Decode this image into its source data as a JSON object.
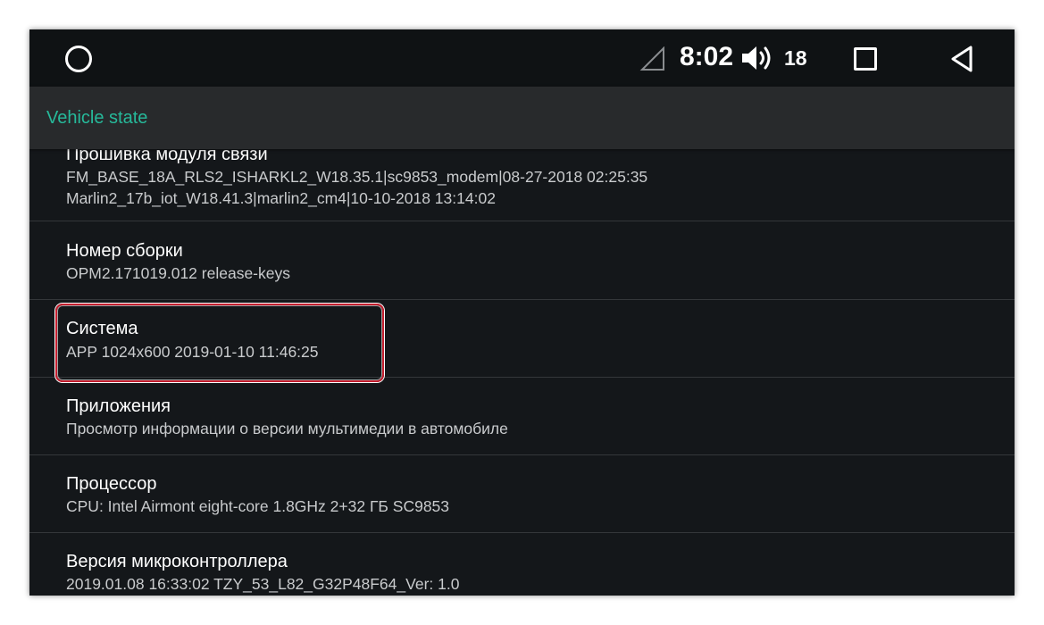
{
  "status_bar": {
    "home_icon": "circle-home-icon",
    "signal_icon": "signal-triangle-icon",
    "time": "8:02",
    "volume_icon": "speaker-volume-icon",
    "volume_level": "18",
    "recents_icon": "square-recents-icon",
    "back_icon": "triangle-back-icon"
  },
  "header": {
    "title": "Vehicle state",
    "accent_color": "#26b99a"
  },
  "items": [
    {
      "title": "Прошивка модуля связи",
      "lines": [
        "FM_BASE_18A_RLS2_ISHARKL2_W18.35.1|sc9853_modem|08-27-2018 02:25:35",
        "Marlin2_17b_iot_W18.41.3|marlin2_cm4|10-10-2018 13:14:02"
      ]
    },
    {
      "title": "Номер сборки",
      "lines": [
        "OPM2.171019.012 release-keys"
      ]
    },
    {
      "title": "Система",
      "lines": [
        "APP 1024x600 2019-01-10 11:46:25"
      ]
    },
    {
      "title": "Приложения",
      "lines": [
        "Просмотр информации о версии мультимедии в автомобиле"
      ]
    },
    {
      "title": "Процессор",
      "lines": [
        "CPU: Intel Airmont eight-core 1.8GHz 2+32 ГБ SC9853"
      ]
    },
    {
      "title": "Версия микроконтроллера",
      "lines": [
        "2019.01.08 16:33:02 TZY_53_L82_G32P48F64_Ver: 1.0"
      ]
    }
  ],
  "highlight_color": "#c41e2e"
}
